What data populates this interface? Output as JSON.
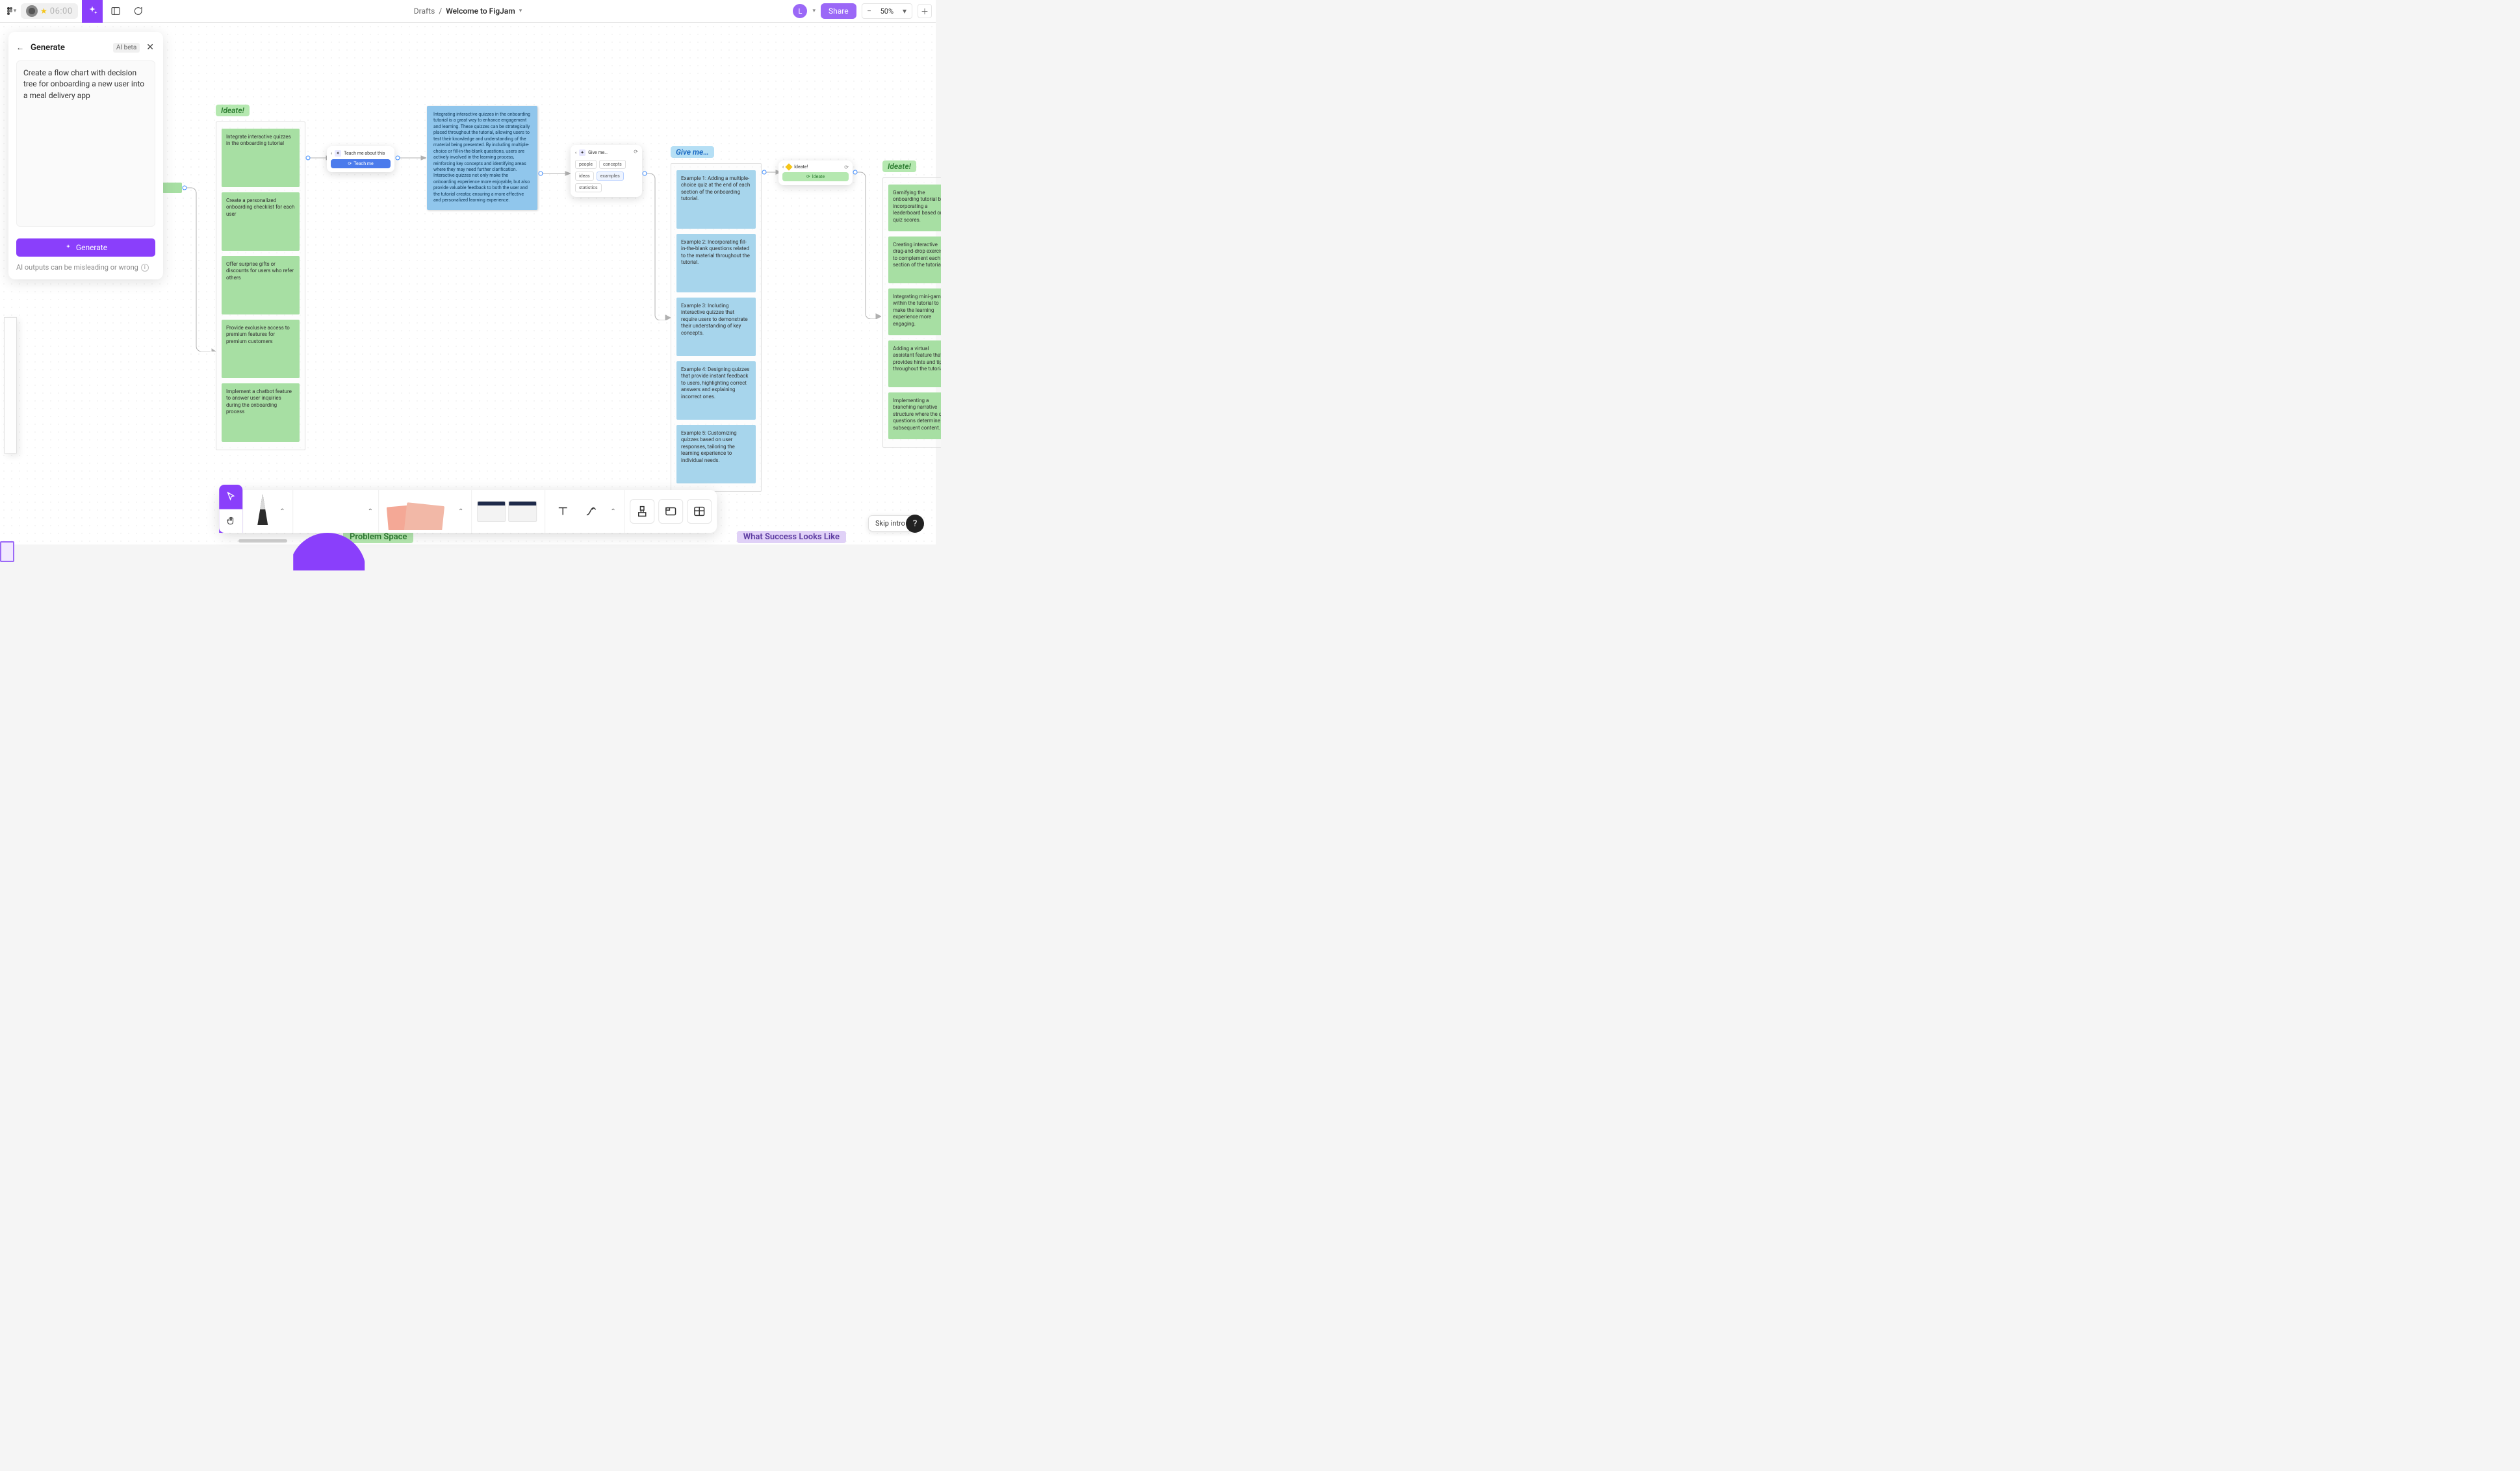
{
  "topbar": {
    "timer": "06:00",
    "breadcrumb_root": "Drafts",
    "breadcrumb_sep": "/",
    "file_name": "Welcome to FigJam",
    "avatar_initial": "L",
    "share_label": "Share",
    "zoom_label": "50%"
  },
  "generate_panel": {
    "title": "Generate",
    "beta_label": "AI beta",
    "prompt_value": "Create a flow chart with decision tree for onboarding a new user into a meal delivery app",
    "generate_label": "Generate",
    "disclaimer": "AI outputs can be misleading or wrong"
  },
  "canvas": {
    "ideate_a": {
      "heading": "Ideate!",
      "items": [
        "Integrate interactive quizzes in the onboarding tutorial",
        "Create a personalized onboarding checklist for each user",
        "Offer surprise gifts or discounts for users who refer others",
        "Provide exclusive access to premium features for premium customers",
        "Implement a chatbot feature to answer user inquiries during the onboarding process"
      ]
    },
    "blue_paragraph": "Integrating interactive quizzes in the onboarding tutorial is a great way to enhance engagement and learning. These quizzes can be strategically placed throughout the tutorial, allowing users to test their knowledge and understanding of the material being presented. By including multiple-choice or fill-in-the-blank questions, users are actively involved in the learning process, reinforcing key concepts and identifying areas where they may need further clarification. Interactive quizzes not only make the onboarding experience more enjoyable, but also provide valuable feedback to both the user and the tutorial creator, ensuring a more effective and personalized learning experience.",
    "teach_chip": {
      "title": "Teach me about this",
      "cta": "Teach me"
    },
    "give_chip": {
      "title": "Give me…",
      "tags": [
        "people",
        "concepts",
        "ideas",
        "examples",
        "statistics"
      ],
      "selected": "examples"
    },
    "give_column": {
      "heading": "Give me…",
      "items": [
        "Example 1: Adding a multiple-choice quiz at the end of each section of the onboarding tutorial.",
        "Example 2: Incorporating fill-in-the-blank questions related to the material throughout the tutorial.",
        "Example 3: Including interactive quizzes that require users to demonstrate their understanding of key concepts.",
        "Example 4: Designing quizzes that provide instant feedback to users, highlighting correct answers and explaining incorrect ones.",
        "Example 5: Customizing quizzes based on user responses, tailoring the learning experience to individual needs."
      ]
    },
    "ideate_chip": {
      "title": "Ideate!",
      "cta": "Ideate"
    },
    "ideate_b": {
      "heading": "Ideate!",
      "items": [
        "Gamifying the onboarding tutorial by incorporating a leaderboard based on quiz scores.",
        "Creating interactive drag-and-drop exercises to complement each section of the tutorial.",
        "Integrating mini-games within the tutorial to make the learning experience more engaging.",
        "Adding a virtual assistant feature that provides hints and tips throughout the tutorial.",
        "Implementing a branching narrative structure where the quiz questions determine the subsequent content."
      ]
    },
    "section_labels": {
      "problem": "Problem Space",
      "success": "What Success Looks Like"
    }
  },
  "bottombar": {
    "skip_label": "Skip intro"
  }
}
